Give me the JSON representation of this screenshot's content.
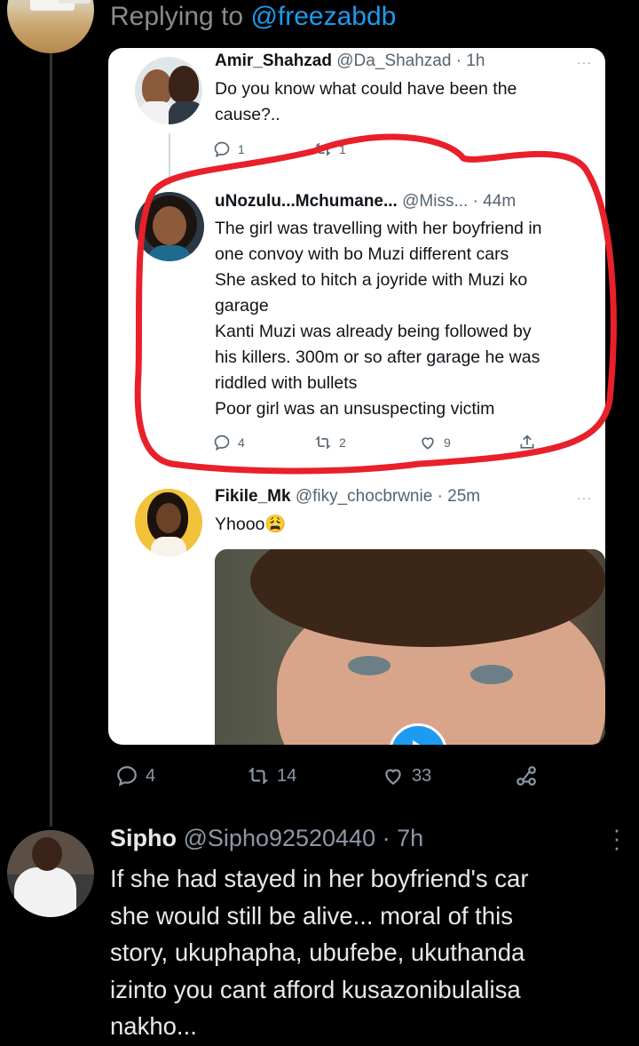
{
  "replying": {
    "prefix": "Replying to",
    "handle": "@freezabdb"
  },
  "quoted": {
    "tweets": [
      {
        "name": "Amir_Shahzad",
        "meta": "@Da_Shahzad · 1h",
        "lines": [
          "Do you know what could have been the",
          "cause?.."
        ],
        "replies": "1",
        "retweets": "1"
      },
      {
        "name": "uNozulu...Mchumane...",
        "meta": "@Miss... · 44m",
        "lines": [
          "The girl was travelling with her boyfriend in",
          "one convoy with bo Muzi different cars",
          "She asked to hitch a joyride with Muzi ko",
          "garage",
          "Kanti Muzi was already being followed by",
          "his killers. 300m or so after garage he was",
          "riddled with bullets",
          "Poor girl was an unsuspecting victim"
        ],
        "replies": "4",
        "retweets": "2",
        "likes": "9"
      },
      {
        "name": "Fikile_Mk",
        "meta": "@fiky_chocbrwnie · 25m",
        "text": "Yhooo😩"
      }
    ],
    "more": "···"
  },
  "outer_actions": {
    "replies": "4",
    "retweets": "14",
    "likes": "33"
  },
  "reply": {
    "name": "Sipho",
    "meta": "@Sipho92520440 · 7h",
    "lines": [
      "If she had stayed in her boyfriend's car",
      "she would still be alive... moral of this",
      "story, ukuphapha, ubufebe, ukuthanda",
      "izinto you cant afford kusazonibulalisa",
      "nakho..."
    ]
  },
  "colors": {
    "link": "#1d9bf0",
    "annotation": "#e8202a"
  },
  "icons": [
    "reply-icon",
    "retweet-icon",
    "like-icon",
    "share-icon",
    "more-icon",
    "play-icon"
  ]
}
